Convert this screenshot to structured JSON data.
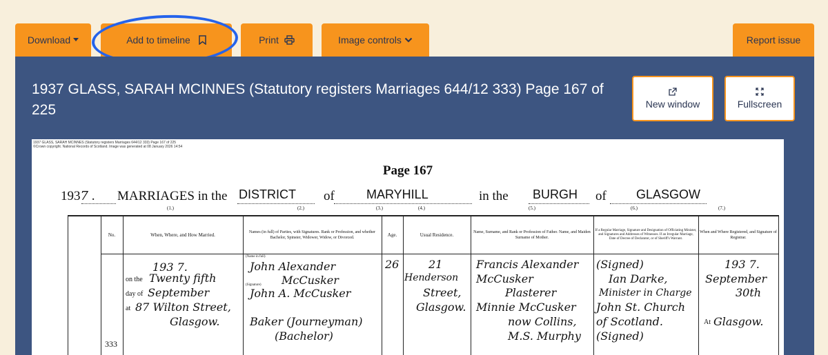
{
  "toolbar": {
    "download": "Download",
    "add_to_timeline": "Add to timeline",
    "print": "Print",
    "image_controls": "Image controls",
    "report_issue": "Report issue"
  },
  "viewer": {
    "title": "1937 GLASS, SARAH MCINNES (Statutory registers Marriages 644/12 333) Page 167 of 225",
    "new_window": "New window",
    "fullscreen": "Fullscreen"
  },
  "document": {
    "copyright_line1": "1937 GLASS, SARAH MCINNES (Statutory registers Marriages 644/12 333) Page 167 of 225",
    "copyright_line2": "©Crown copyright. National Records of Scotland. Image was generated at 08 January 2026 14:54",
    "page_label": "Page 167",
    "year_prefix": "193",
    "year_suffix": "7",
    "marriages_in_the": "MARRIAGES in the",
    "district_word": "DISTRICT",
    "of_word": "of",
    "district_name": "MARYHILL",
    "in_the": "in the",
    "burgh_word": "BURGH",
    "of_word2": "of",
    "burgh_name": "GLASGOW",
    "col_numbers": [
      "(1.)",
      "(2.)",
      "(3.)",
      "(4.)",
      "(5.)",
      "(6.)",
      "(7.)"
    ],
    "headers": {
      "no": "No.",
      "when_where": "When, Where, and How Married.",
      "names": "Names (in full) of Parties, with Signatures. Rank or Profession, and whether Bachelor, Spinster, Widower, Widow, or Divorced.",
      "age": "Age.",
      "residence": "Usual Residence.",
      "father": "Name, Surname, and Rank or Profession of Father. Name, and Maiden Surname of Mother.",
      "minister": "If a Regular Marriage, Signature and Designation of Officiating Minister, and Signatures and Addresses of Witnesses. If an Irregular Marriage, Date of Decree of Declarator, or of Sheriff's Warrant.",
      "registered": "When and Where Registered, and Signature of Registrar."
    },
    "entry": {
      "number": "333",
      "year": "193 7.",
      "on_the": "on the",
      "date_day": "Twenty fifth",
      "day_of": "day of",
      "month": "September",
      "at": "at",
      "address1": "87 Wilton Street,",
      "address2": "Glasgow.",
      "name_label": "(Name in full)",
      "groom_first": "John Alexander",
      "groom_surname": "McCusker",
      "signature_label": "(Signature)",
      "groom_signature": "John A. McCusker",
      "groom_occupation": "Baker (Journeyman)",
      "groom_status": "(Bachelor)",
      "age": "26",
      "res1": "21",
      "res2": "Henderson",
      "res3": "Street,",
      "res4": "Glasgow.",
      "father1": "Francis Alexander",
      "father2": "McCusker",
      "father3": "Plasterer",
      "mother1": "Minnie McCusker",
      "mother2": "now Collins,",
      "mother3": "M.S. Murphy",
      "min1": "(Signed)",
      "min2": "Ian Darke,",
      "min3": "Minister in Charge",
      "min4": "John St. Church",
      "min5": "of Scotland.",
      "min6": "(Signed)",
      "reg1": "193 7.",
      "reg2": "September",
      "reg3": "30th",
      "reg_at": "At",
      "reg4": "Glasgow."
    }
  }
}
